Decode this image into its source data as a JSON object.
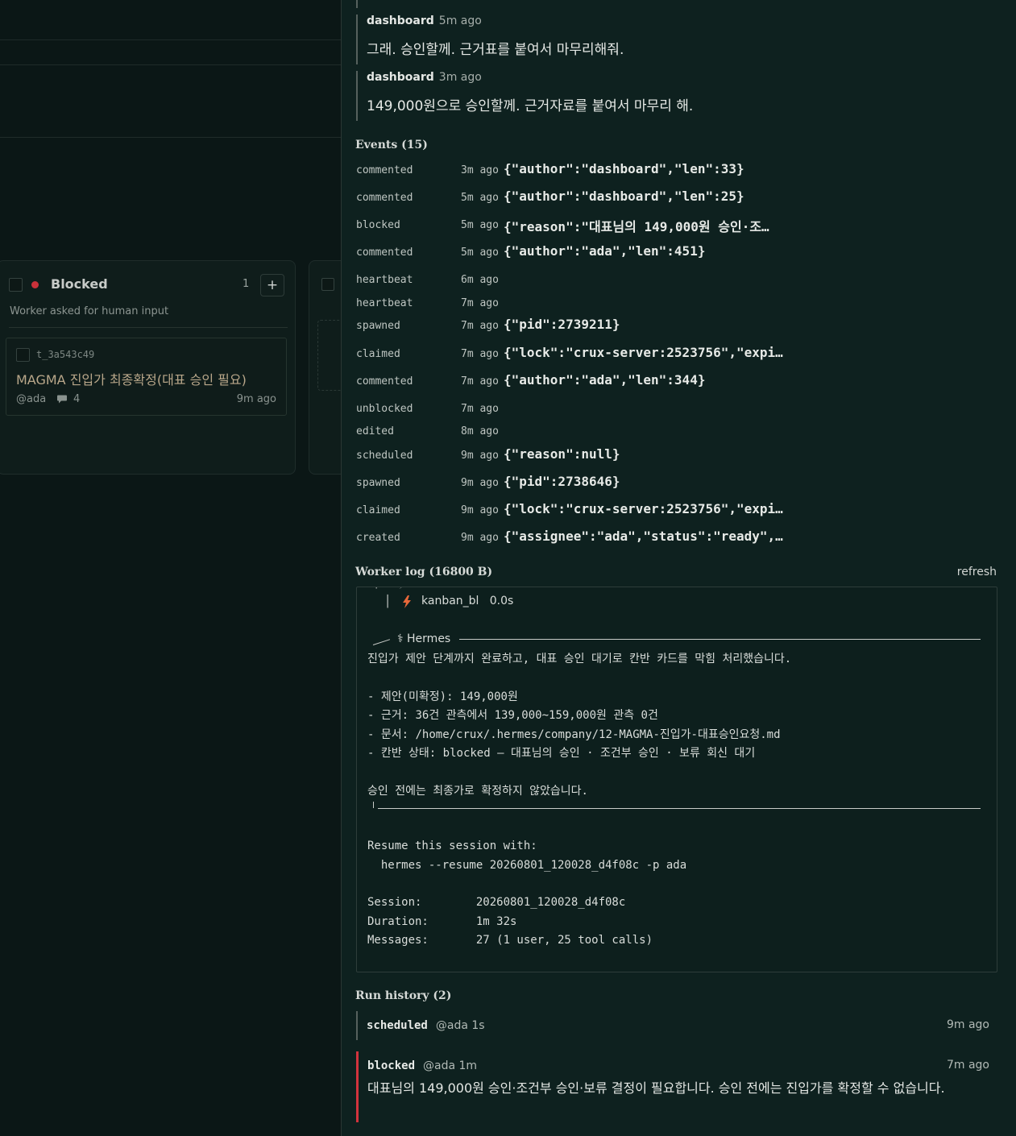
{
  "board": {
    "column": {
      "title": "Blocked",
      "count": "1",
      "add_label": "+",
      "subtitle": "Worker asked for human input",
      "status_color": "#c9313a"
    },
    "card": {
      "id": "t_3a543c49",
      "title": "MAGMA 진입가 최종확정(대표 승인 필요)",
      "owner": "@ada",
      "comment_count": "4",
      "age": "9m ago"
    }
  },
  "comments": [
    {
      "author": "dashboard",
      "time": "5m ago",
      "body": "그래. 승인할께. 근거표를 붙여서 마무리해줘."
    },
    {
      "author": "dashboard",
      "time": "3m ago",
      "body": "149,000원으로 승인할께. 근거자료를 붙여서 마무리 해."
    }
  ],
  "events": {
    "title": "Events (15)",
    "items": [
      {
        "type": "commented",
        "time": "3m ago",
        "data": "{\"author\":\"dashboard\",\"len\":33}"
      },
      {
        "type": "commented",
        "time": "5m ago",
        "data": "{\"author\":\"dashboard\",\"len\":25}"
      },
      {
        "type": "blocked",
        "time": "5m ago",
        "data": "{\"reason\":\"대표님의 149,000원 승인·조…"
      },
      {
        "type": "commented",
        "time": "5m ago",
        "data": "{\"author\":\"ada\",\"len\":451}"
      },
      {
        "type": "heartbeat",
        "time": "6m ago",
        "data": ""
      },
      {
        "type": "heartbeat",
        "time": "7m ago",
        "data": ""
      },
      {
        "type": "spawned",
        "time": "7m ago",
        "data": "{\"pid\":2739211}"
      },
      {
        "type": "claimed",
        "time": "7m ago",
        "data": "{\"lock\":\"crux-server:2523756\",\"expi…"
      },
      {
        "type": "commented",
        "time": "7m ago",
        "data": "{\"author\":\"ada\",\"len\":344}"
      },
      {
        "type": "unblocked",
        "time": "7m ago",
        "data": ""
      },
      {
        "type": "edited",
        "time": "8m ago",
        "data": ""
      },
      {
        "type": "scheduled",
        "time": "9m ago",
        "data": "{\"reason\":null}"
      },
      {
        "type": "spawned",
        "time": "9m ago",
        "data": "{\"pid\":2738646}"
      },
      {
        "type": "claimed",
        "time": "9m ago",
        "data": "{\"lock\":\"crux-server:2523756\",\"expi…"
      },
      {
        "type": "created",
        "time": "9m ago",
        "data": "{\"assignee\":\"ada\",\"status\":\"ready\",…"
      }
    ]
  },
  "worker_log": {
    "title": "Worker log (16800 B)",
    "refresh_label": "refresh",
    "tool_line": "kanban_bl   0.0s",
    "box_title": "Hermes",
    "lines": [
      "진입가 제안 단계까지 완료하고, 대표 승인 대기로 칸반 카드를 막힘 처리했습니다.",
      "- 제안(미확정): 149,000원",
      "- 근거: 36건 관측에서 139,000~159,000원 관측 0건",
      "- 문서: /home/crux/.hermes/company/12-MAGMA-진입가-대표승인요청.md",
      "- 칸반 상태: blocked — 대표님의 승인 · 조건부 승인 · 보류 회신 대기",
      "승인 전에는 최종가로 확정하지 않았습니다."
    ],
    "resume_label": "Resume this session with:",
    "resume_cmd": "  hermes --resume 20260801_120028_d4f08c -p ada",
    "session_line": "Session:        20260801_120028_d4f08c",
    "duration_line": "Duration:       1m 32s",
    "messages_line": "Messages:       27 (1 user, 25 tool calls)"
  },
  "run_history": {
    "title": "Run history (2)",
    "runs": [
      {
        "status": "scheduled",
        "meta": "@ada  1s",
        "time": "9m ago",
        "summary": ""
      },
      {
        "status": "blocked",
        "meta": "@ada  1m",
        "time": "7m ago",
        "summary": "대표님의 149,000원 승인·조건부 승인·보류 결정이 필요합니다. 승인 전에는 진입가를 확정할 수 없습니다.",
        "accent": "#d3333d"
      }
    ]
  }
}
